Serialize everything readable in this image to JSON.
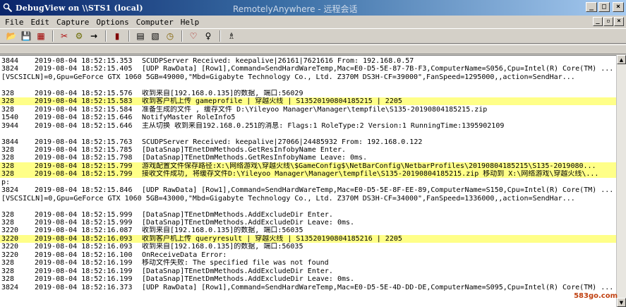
{
  "window": {
    "title": "DebugView on \\\\STS1 (local)",
    "overlay": "RemotelyAnywhere - 远程会话",
    "min_glyph": "_",
    "max_glyph": "□",
    "close_glyph": "×"
  },
  "menu": {
    "items": [
      "File",
      "Edit",
      "Capture",
      "Options",
      "Computer",
      "Help"
    ],
    "mdi_min": "_",
    "mdi_max": "▫",
    "mdi_close": "×"
  },
  "toolbar": {
    "icons": [
      "open-icon",
      "save-icon",
      "clear-icon",
      "find-tool-icon",
      "capture-icon",
      "arrow-icon",
      "scroll-icon",
      "filter-icon",
      "history-icon",
      "clock-icon",
      "highlight-icon",
      "pin-icon",
      "binoculars-icon"
    ],
    "glyphs": [
      "📂",
      "💾",
      "▦",
      "✂",
      "⚙",
      "→",
      "▮",
      "▤",
      "▧",
      "◷",
      "♡",
      "♀",
      "♗"
    ]
  },
  "highlight_color": "#ffff88",
  "log": [
    {
      "pid": "3844",
      "ts": "2019-08-04 18:52:15.353",
      "msg": "SCUDPServer Received: keepalive|26161|7621616 From: 192.168.0.57",
      "hl": false
    },
    {
      "pid": "3824",
      "ts": "2019-08-04 18:52:15.405",
      "msg": "[UDP RawData] [Row1],Command=SendHardWareTemp,Mac=E0-D5-5E-87-7B-F3,ComputerName=S056,Cpu=Intel(R) Core(TM) ...",
      "hl": false
    },
    {
      "full": "[VSCSICLN]=0,Gpu=GeForce GTX 1060 5GB=49000,\"Mbd=Gigabyte Technology Co., Ltd.  Z370M DS3H-CF=39000\",FanSpeed=1295000,,action=SendHar...",
      "hl": false
    },
    {
      "blank": true
    },
    {
      "pid": "328",
      "ts": "2019-08-04 18:52:15.576",
      "msg": "收到来自[192.168.0.135]的数据, 端口:56029",
      "hl": false
    },
    {
      "pid": "328",
      "ts": "2019-08-04 18:52:15.583",
      "msg": "收到客户机上传 gameprofile  |  穿越火线  |  S13520190804185215  |  2205",
      "hl": true
    },
    {
      "pid": "328",
      "ts": "2019-08-04 18:52:15.584",
      "msg": "准备生成的文件 , 缓存文件 D:\\Yileyoo Manager\\Manager\\tempfile\\S135-20190804185215.zip",
      "hl": false
    },
    {
      "pid": "1540",
      "ts": "2019-08-04 18:52:15.646",
      "msg": "NotifyMaster RoleInfo5",
      "hl": false
    },
    {
      "pid": "3944",
      "ts": "2019-08-04 18:52:15.646",
      "msg": "主从切换 收到来自192.168.0.251的消息: Flags:1 RoleType:2 Version:1 RunningTime:1395902109",
      "hl": false
    },
    {
      "blank": true
    },
    {
      "pid": "3844",
      "ts": "2019-08-04 18:52:15.763",
      "msg": "SCUDPServer Received: keepalive|27066|24485932 From: 192.168.0.122",
      "hl": false
    },
    {
      "pid": "328",
      "ts": "2019-08-04 18:52:15.785",
      "msg": "[DataSnap]TEnetDmMethods.GetResInfobyName Enter.",
      "hl": false
    },
    {
      "pid": "328",
      "ts": "2019-08-04 18:52:15.798",
      "msg": "[DataSnap]TEnetDmMethods.GetResInfobyName Leave: 0ms.",
      "hl": false
    },
    {
      "pid": "328",
      "ts": "2019-08-04 18:52:15.799",
      "msg": "游戏配置文件保存路径:X:\\网络游戏\\穿越火线\\$GameConfig$\\NetBarConfig\\NetbarProfiles\\20190804185215\\S135-2019080...",
      "hl": true
    },
    {
      "pid": "328",
      "ts": "2019-08-04 18:52:15.799",
      "msg": "接收文件成功, 将缓存文件D:\\Yileyoo Manager\\Manager\\tempfile\\S135-20190804185215.zip 移动到 X:\\网络游戏\\穿越火线\\...",
      "hl": true
    },
    {
      "full": "p:",
      "hl": false
    },
    {
      "pid": "3824",
      "ts": "2019-08-04 18:52:15.846",
      "msg": "[UDP RawData] [Row1],Command=SendHardWareTemp,Mac=E0-D5-5E-8F-EE-89,ComputerName=S150,Cpu=Intel(R) Core(TM) ...",
      "hl": false
    },
    {
      "full": "[VSCSICLN]=0,Gpu=GeForce GTX 1060 5GB=43000,\"Mbd=Gigabyte Technology Co., Ltd.  Z370M DS3H-CF=34000\",FanSpeed=1336000,,action=SendHar...",
      "hl": false
    },
    {
      "blank": true
    },
    {
      "pid": "328",
      "ts": "2019-08-04 18:52:15.999",
      "msg": "[DataSnap]TEnetDmMethods.AddExcludeDir Enter.",
      "hl": false
    },
    {
      "pid": "328",
      "ts": "2019-08-04 18:52:15.999",
      "msg": "[DataSnap]TEnetDmMethods.AddExcludeDir Leave: 0ms.",
      "hl": false
    },
    {
      "pid": "3220",
      "ts": "2019-08-04 18:52:16.087",
      "msg": "收到来自[192.168.0.135]的数据, 端口:56035",
      "hl": false
    },
    {
      "pid": "3220",
      "ts": "2019-08-04 18:52:16.093",
      "msg": "收到客户机上传 queryresult  |  穿越火线  |  S13520190804185216  |  2205",
      "hl": true
    },
    {
      "pid": "3220",
      "ts": "2019-08-04 18:52:16.093",
      "msg": "收到来自[192.168.0.135]的数据, 端口:56035",
      "hl": false
    },
    {
      "pid": "3220",
      "ts": "2019-08-04 18:52:16.100",
      "msg": "OnReceiveData Error:",
      "hl": false
    },
    {
      "pid": "328",
      "ts": "2019-08-04 18:52:16.199",
      "msg": "移动文件失败: The specified file was not found",
      "hl": false
    },
    {
      "pid": "328",
      "ts": "2019-08-04 18:52:16.199",
      "msg": "[DataSnap]TEnetDmMethods.AddExcludeDir Enter.",
      "hl": false
    },
    {
      "pid": "328",
      "ts": "2019-08-04 18:52:16.199",
      "msg": "[DataSnap]TEnetDmMethods.AddExcludeDir Leave: 0ms.",
      "hl": false
    },
    {
      "pid": "3824",
      "ts": "2019-08-04 18:52:16.373",
      "msg": "[UDP RawData] [Row1],Command=SendHardWareTemp,Mac=E0-D5-5E-4D-DD-DE,ComputerName=S095,Cpu=Intel(R) Core(TM) ...",
      "hl": false
    }
  ],
  "watermark": "583go.com"
}
